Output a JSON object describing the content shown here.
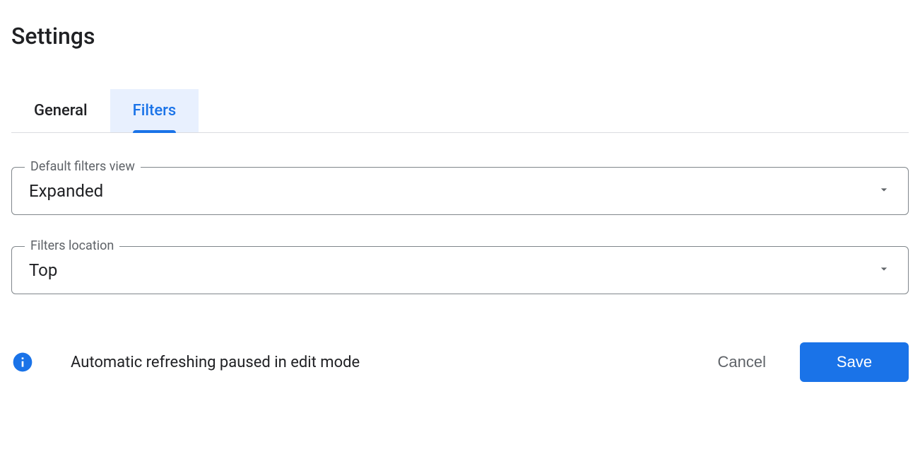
{
  "page_title": "Settings",
  "tabs": [
    {
      "label": "General",
      "active": false
    },
    {
      "label": "Filters",
      "active": true
    }
  ],
  "fields": {
    "default_filters_view": {
      "label": "Default filters view",
      "value": "Expanded"
    },
    "filters_location": {
      "label": "Filters location",
      "value": "Top"
    }
  },
  "status_message": "Automatic refreshing paused in edit mode",
  "buttons": {
    "cancel": "Cancel",
    "save": "Save"
  }
}
